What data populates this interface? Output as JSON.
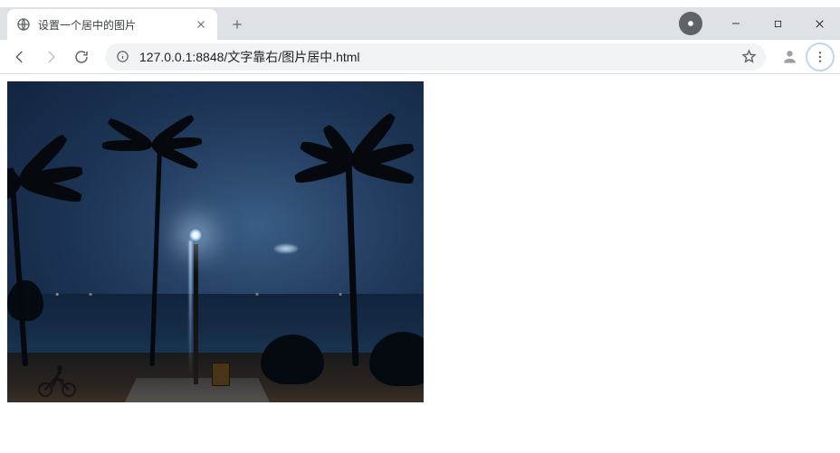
{
  "tab": {
    "title": "设置一个居中的图片"
  },
  "omnibox": {
    "url": "127.0.0.1:8848/文字靠右/图片居中.html"
  }
}
